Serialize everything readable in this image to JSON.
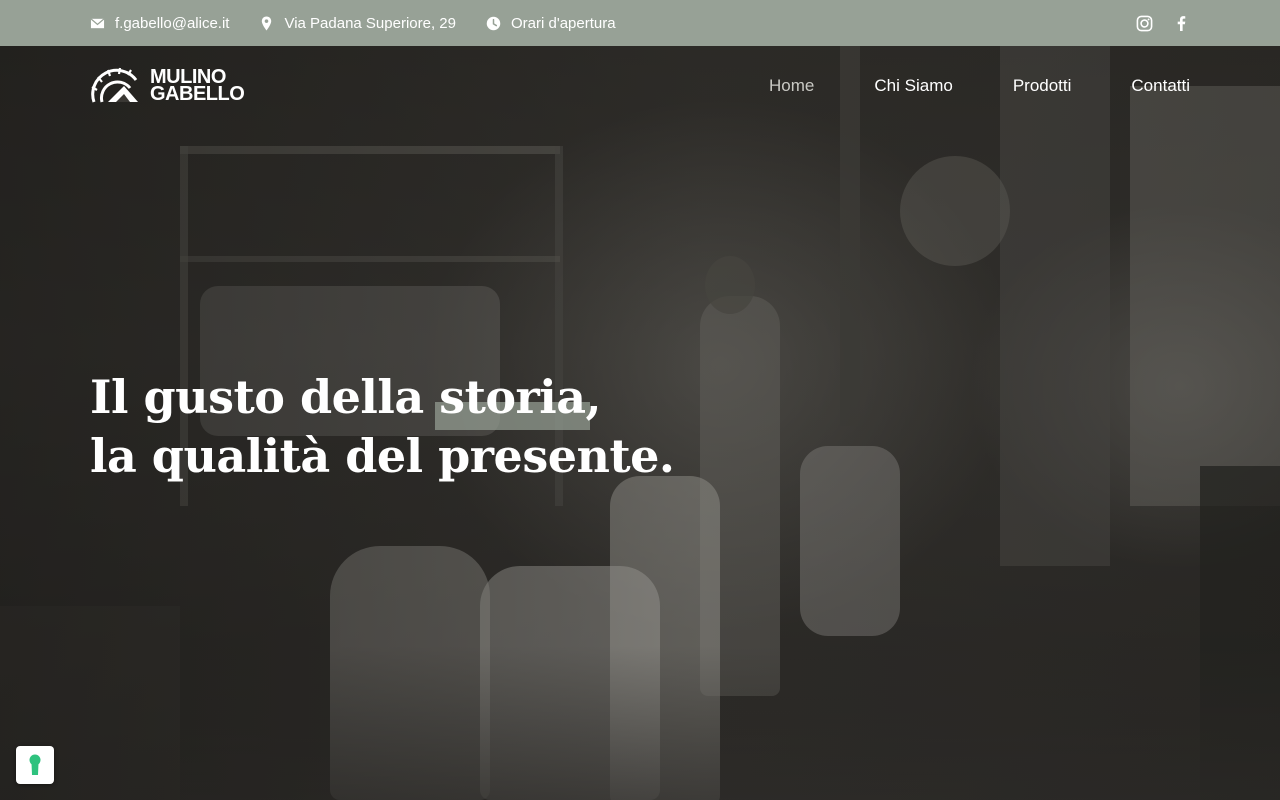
{
  "topbar": {
    "email": "f.gabello@alice.it",
    "address": "Via Padana Superiore, 29",
    "hours": "Orari d'apertura",
    "social": [
      "instagram-icon",
      "facebook-icon"
    ]
  },
  "logo": {
    "line1": "MULINO",
    "line2": "GABELLO"
  },
  "nav": {
    "items": [
      {
        "label": "Home",
        "active": true
      },
      {
        "label": "Chi Siamo",
        "active": false
      },
      {
        "label": "Prodotti",
        "active": false
      },
      {
        "label": "Contatti",
        "active": false
      }
    ]
  },
  "hero": {
    "line1_pre": "Il gusto della ",
    "line1_highlight": "storia",
    "line1_post": ",",
    "line2": "la qualità del presente."
  },
  "colors": {
    "topbar": "#97a196",
    "highlight": "#97a196",
    "cookie_icon": "#2ec27e"
  }
}
